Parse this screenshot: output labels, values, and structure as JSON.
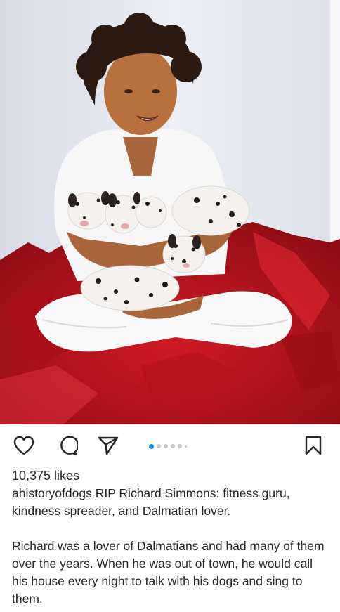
{
  "post": {
    "image_alt": "Richard Simmons in white clothes holding Dalmatian puppies on red tissue paper",
    "likes": "10,375 likes",
    "username": "ahistoryofdogs",
    "caption_line1": "RIP Richard Simmons: fitness guru, kindness spreader, and Dalmatian lover.",
    "caption_para2": "Richard was a lover of Dalmatians and had many of them over the years. When he was out of town, he would call his house every night to talk with his dogs and sing to them."
  },
  "actions": {
    "like_icon": "heart-icon",
    "comment_icon": "comment-icon",
    "share_icon": "paper-plane-icon",
    "save_icon": "bookmark-icon"
  },
  "carousel": {
    "total_dots": 6,
    "active_index": 0,
    "active_color": "#1b8fe0"
  },
  "colors": {
    "tissue_red": "#c3141f",
    "background_wall": "#e4e6ee"
  }
}
